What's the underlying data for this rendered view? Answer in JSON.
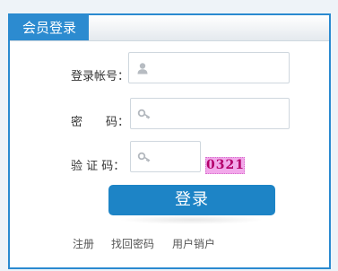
{
  "header": {
    "title": "会员登录"
  },
  "form": {
    "username": {
      "label": "登录帐号：",
      "value": "",
      "icon": "user-icon"
    },
    "password": {
      "label": "密　　码：",
      "value": "",
      "icon": "key-icon"
    },
    "captcha": {
      "label": "验 证 码：",
      "value": "",
      "icon": "key-icon",
      "code": "0321"
    },
    "submit_label": "登录"
  },
  "links": {
    "register": "注册",
    "recover_password": "找回密码",
    "cancel_account": "用户销户"
  },
  "colors": {
    "accent": "#1d84c6",
    "border": "#2a8ad0",
    "captcha_bg": "#f2a8ea"
  }
}
